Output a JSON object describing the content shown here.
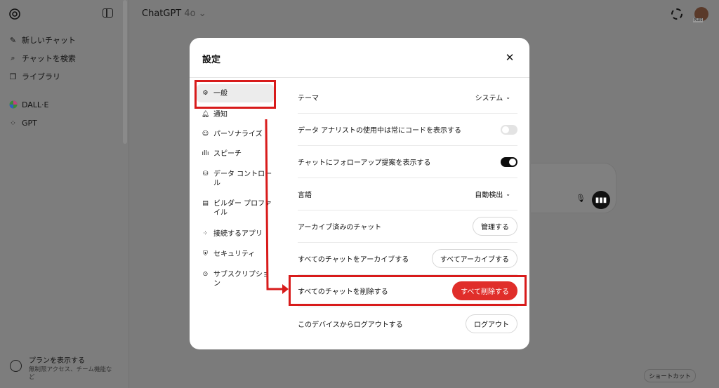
{
  "app": {
    "title": "ChatGPT",
    "model": "4o",
    "plan_badge": "PLUS"
  },
  "sidebar": {
    "items": [
      {
        "label": "新しいチャット",
        "icon": "new-chat-icon"
      },
      {
        "label": "チャットを検索",
        "icon": "search-icon"
      },
      {
        "label": "ライブラリ",
        "icon": "library-icon"
      },
      {
        "label": "DALL·E",
        "icon": "dalle-icon"
      },
      {
        "label": "GPT",
        "icon": "gpt-grid-icon"
      }
    ],
    "plan": {
      "title": "プランを表示する",
      "subtitle": "無制限アクセス、チーム機能など"
    }
  },
  "shortcut_label": "ショートカット",
  "settings": {
    "title": "設定",
    "nav": [
      {
        "label": "一般",
        "icon": "gear-icon",
        "active": true
      },
      {
        "label": "通知",
        "icon": "bell-icon"
      },
      {
        "label": "パーソナライズ",
        "icon": "person-icon"
      },
      {
        "label": "スピーチ",
        "icon": "waveform-icon"
      },
      {
        "label": "データ コントロール",
        "icon": "database-icon"
      },
      {
        "label": "ビルダー プロファイル",
        "icon": "profile-card-icon"
      },
      {
        "label": "接続するアプリ",
        "icon": "apps-grid-icon"
      },
      {
        "label": "セキュリティ",
        "icon": "shield-icon"
      },
      {
        "label": "サブスクリプション",
        "icon": "subscription-icon"
      }
    ],
    "rows": {
      "theme": {
        "label": "テーマ",
        "value": "システム"
      },
      "show_code": {
        "label": "データ アナリストの使用中は常にコードを表示する",
        "on": false
      },
      "follow_up": {
        "label": "チャットにフォローアップ提案を表示する",
        "on": true
      },
      "language": {
        "label": "言語",
        "value": "自動検出"
      },
      "archived": {
        "label": "アーカイブ済みのチャット",
        "button": "管理する"
      },
      "archive_all": {
        "label": "すべてのチャットをアーカイブする",
        "button": "すべてアーカイブする"
      },
      "delete_all": {
        "label": "すべてのチャットを削除する",
        "button": "すべて削除する"
      },
      "logout": {
        "label": "このデバイスからログアウトする",
        "button": "ログアウト"
      }
    }
  },
  "colors": {
    "danger": "#e02e2a",
    "annotation": "#d81b1b",
    "overlay": "#7b7b7b"
  }
}
